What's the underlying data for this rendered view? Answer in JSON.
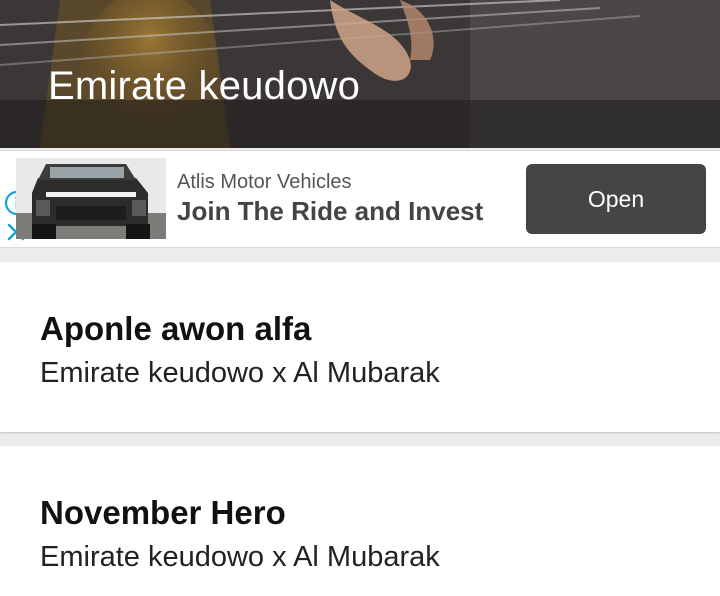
{
  "header": {
    "title": "Emirate keudowo"
  },
  "ad": {
    "brand": "Atlis Motor Vehicles",
    "headline": "Join The Ride and Invest",
    "cta_label": "Open",
    "info_icon": "info-icon",
    "close_icon": "close-icon"
  },
  "songs": [
    {
      "title": "Aponle awon alfa",
      "artist": "Emirate keudowo x Al Mubarak"
    },
    {
      "title": "November Hero",
      "artist": "Emirate keudowo x Al Mubarak"
    }
  ],
  "colors": {
    "ad_button": "#454545",
    "info_icon": "#1a9fd9",
    "card_bg": "#ffffff"
  }
}
